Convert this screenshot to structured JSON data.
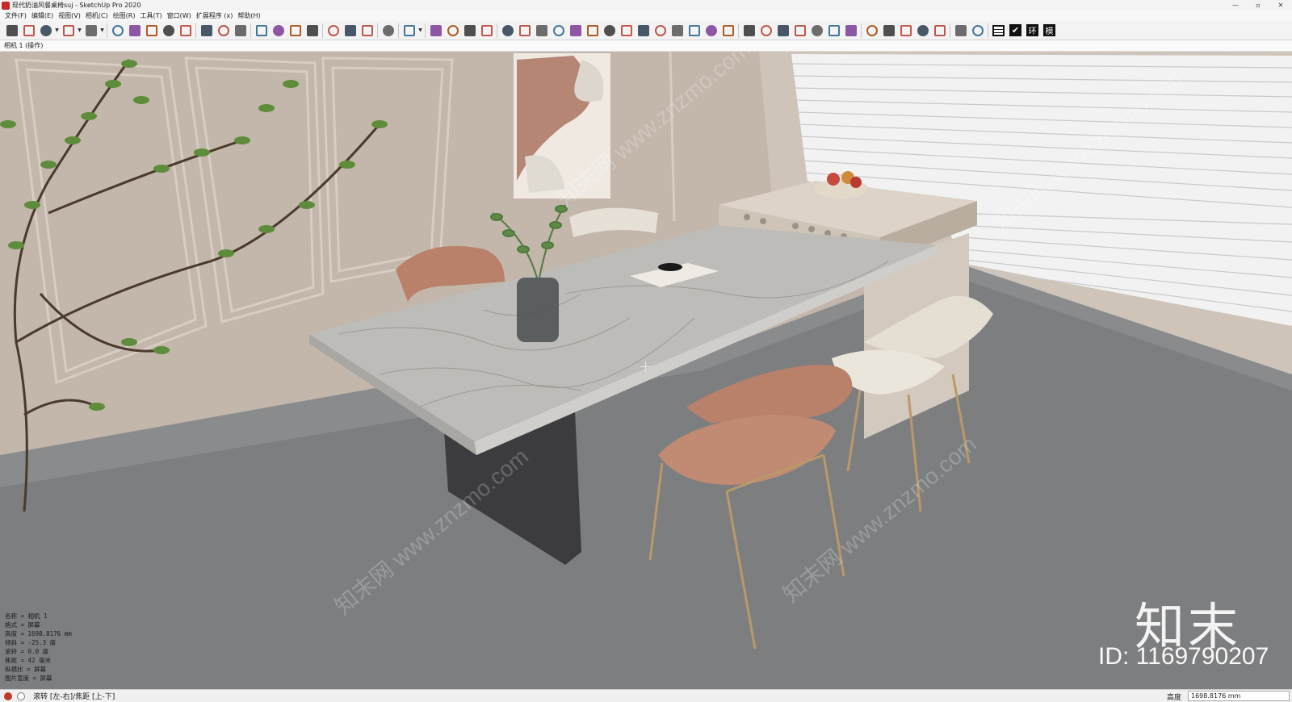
{
  "window": {
    "title": "现代奶油风餐桌椅suj - SketchUp Pro 2020",
    "minimize": "—",
    "maximize": "▫",
    "close": "✕"
  },
  "menu": [
    "文件(F)",
    "编辑(E)",
    "视图(V)",
    "相机(C)",
    "绘图(R)",
    "工具(T)",
    "窗口(W)",
    "扩展程序 (x)",
    "帮助(H)"
  ],
  "toolbar": {
    "icons": [
      "select-icon",
      "eraser-icon",
      "pencil-icon",
      "dropdown",
      "arc-icon",
      "dropdown",
      "shape-icon",
      "dropdown",
      "sep",
      "push-pull-icon",
      "offset-icon",
      "move-icon",
      "rotate-icon",
      "scale-icon",
      "sep",
      "tape-measure-icon",
      "text-icon",
      "paint-bucket-icon",
      "sep",
      "orbit-icon",
      "pan-icon",
      "zoom-icon",
      "zoom-extents-icon",
      "sep",
      "warehouse-icon",
      "extension-warehouse-icon",
      "layout-icon",
      "sep",
      "ruby-icon",
      "sep",
      "profile-icon",
      "dropdown",
      "sep",
      "sandbox-icon",
      "grid-icon",
      "slope-icon",
      "chart-icon",
      "sep",
      "plugin-icon",
      "plugin-icon",
      "plugin-icon",
      "plugin-icon",
      "plugin-icon",
      "plugin-icon",
      "plugin-icon",
      "plugin-icon",
      "plugin-icon",
      "plugin-icon",
      "plugin-icon",
      "plugin-icon",
      "plugin-icon",
      "plugin-icon",
      "sep",
      "plugin-icon",
      "plugin-icon",
      "plugin-icon",
      "plugin-icon",
      "plugin-icon",
      "plugin-icon",
      "plugin-icon",
      "sep",
      "plugin-icon",
      "plugin-icon",
      "plugin-icon",
      "plugin-icon",
      "plugin-icon",
      "sep",
      "style-icon",
      "shadow-icon",
      "sep",
      "table-icon",
      "check-icon",
      "huan-icon",
      "mo-icon"
    ],
    "text_buttons": {
      "huan": "环",
      "mo": "模"
    }
  },
  "scene_tab": "相机 1 (操作)",
  "camera_info": [
    "名称 = 相机 1",
    "格式 = 屏幕",
    "高度 = 1698.8176 mm",
    "倾斜 = -25.3 度",
    "滚转 = 0.0 度",
    "焦距 = 42 毫米",
    "纵横比 = 屏幕",
    "图片宽度 = 屏幕"
  ],
  "watermark": {
    "logo": "知末",
    "id": "ID: 1169790207",
    "diagonal": "知末网 www.znzmo.com"
  },
  "status": {
    "text": "滚转 [左-右]/焦距 [上-下]",
    "measure_label": "高度",
    "measure_value": "1698.8176 mm"
  },
  "colors": {
    "wall": "#c3b6ab",
    "floor": "#7d7e80",
    "marble": "#b8b8b6",
    "copper": "#b9806a",
    "cream": "#e6e0d6",
    "table_base": "#3c3c3e",
    "brass": "#b89a6a"
  }
}
